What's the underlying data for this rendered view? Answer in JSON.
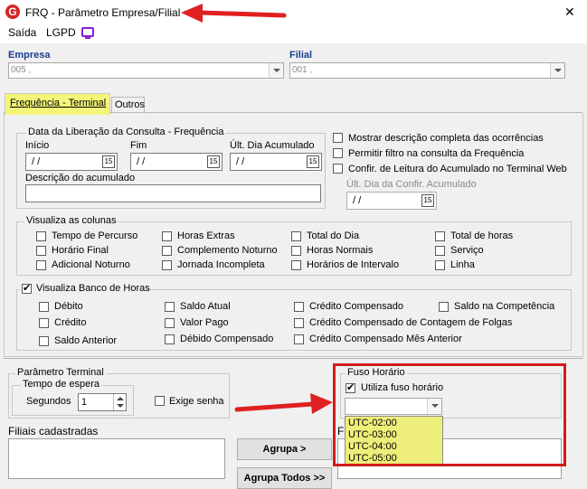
{
  "window": {
    "title": "FRQ - Parâmetro Empresa/Filial",
    "close_glyph": "✕",
    "app_icon_letter": "G"
  },
  "menu": {
    "items": [
      "Saída",
      "LGPD"
    ]
  },
  "empresa": {
    "label": "Empresa",
    "value": "005 ,"
  },
  "filial": {
    "label": "Filial",
    "value": "001 ,"
  },
  "tabs": [
    {
      "label": "Frequência - Terminal",
      "active": true
    },
    {
      "label": "Outros",
      "active": false
    }
  ],
  "liberacao": {
    "title": "Data da Liberação da Consulta  - Frequência",
    "inicio_label": "Início",
    "inicio_value": " /  /",
    "fim_label": "Fim",
    "fim_value": " /  /",
    "ult_label": "Últ. Dia Acumulado",
    "ult_value": " /  /",
    "descricao_label": "Descrição do acumulado",
    "descricao_value": "",
    "cal_glyph": "15"
  },
  "right_checks": [
    {
      "label": "Mostrar descrição completa das ocorrências",
      "checked": false
    },
    {
      "label": "Permitir filtro na consulta da Frequência",
      "checked": false
    },
    {
      "label": "Confir. de Leitura do Acumulado no Terminal Web",
      "checked": false
    }
  ],
  "ult_confir": {
    "label": "Últ. Dia da Confir. Acumulado",
    "value": " /  /"
  },
  "colunas": {
    "title": "Visualiza as colunas",
    "items": [
      "Tempo de Percurso",
      "Horas Extras",
      "Total do Dia",
      "Total de horas",
      "Horário Final",
      "Complemento Noturno",
      "Horas Normais",
      "Serviço",
      "Adicional Noturno",
      "Jornada Incompleta",
      "Horários de Intervalo",
      "Linha"
    ]
  },
  "banco": {
    "title": "Visualiza Banco de Horas",
    "checked": true,
    "items": [
      "Débito",
      "Saldo Atual",
      "Crédito Compensado",
      "Saldo na Competência",
      "Crédito",
      "Valor Pago",
      "Crédito Compensado de Contagem de Folgas",
      "Saldo Anterior",
      "Débido Compensado",
      "Crédito Compensado Mês Anterior"
    ]
  },
  "terminal": {
    "title": "Parâmetro Terminal",
    "espera_title": "Tempo de espera",
    "segundos_label": "Segundos",
    "segundos_value": "1",
    "exige_senha_label": "Exige senha",
    "exige_senha_checked": false
  },
  "fuso": {
    "title": "Fuso Horário",
    "utiliza_label": "Utiliza fuso horário",
    "utiliza_checked": true,
    "selected": "",
    "options": [
      "UTC-02:00",
      "UTC-03:00",
      "UTC-04:00",
      "UTC-05:00"
    ]
  },
  "filiais": {
    "label": "Filiais cadastradas",
    "label2": "F"
  },
  "buttons": {
    "agrupa": "Agrupa >",
    "agrupa_todos": "Agrupa Todos >>"
  },
  "colors": {
    "highlight": "#f5f57a",
    "annotation_red": "#d21b1b",
    "label_blue": "#1a3d8f"
  }
}
